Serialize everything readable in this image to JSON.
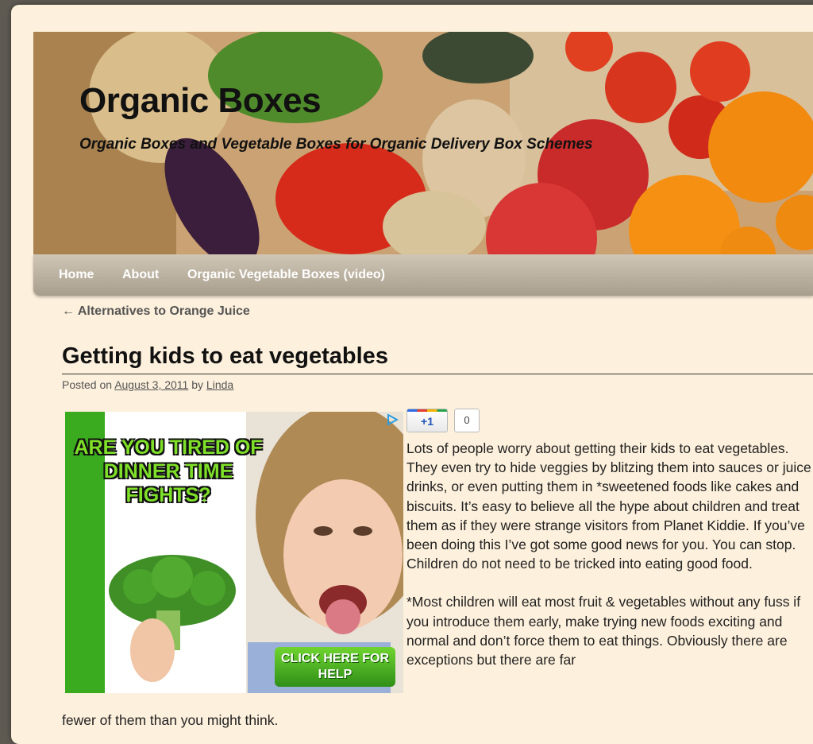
{
  "site": {
    "title": "Organic Boxes",
    "description": "Organic Boxes and Vegetable Boxes for Organic Delivery Box Schemes"
  },
  "nav": {
    "items": [
      {
        "label": "Home"
      },
      {
        "label": "About"
      },
      {
        "label": "Organic Vegetable Boxes (video)"
      }
    ]
  },
  "post": {
    "previous_link": "← Alternatives to Orange Juice",
    "title": "Getting kids to eat vegetables",
    "posted_on_label": "Posted on",
    "date": "August 3, 2011",
    "by_label": "by",
    "author": "Linda",
    "paragraphs": [
      "Lots of people worry about getting their kids to eat vegetables. They even try to hide veggies by blitzing them into sauces or juice drinks, or even putting them in *sweetened foods like cakes and biscuits. It’s easy to believe all the hype about children and treat them as if they were strange visitors from Planet Kiddie. If you’ve been doing this I’ve got some good news for you. You can stop. Children do not need to be tricked into eating good food.",
      "*Most children will eat most fruit & vegetables without any fuss if you introduce them early, make trying new foods exciting and normal and don’t force them to eat things. Obviously there are exceptions but there are far"
    ],
    "paragraph_tail": "fewer of them than you might think."
  },
  "ad": {
    "headline": "Are you tired of dinner time fights?",
    "cta": "CLICK HERE FOR HELP"
  },
  "social": {
    "plusone_label": "+1",
    "plusone_count": "0"
  }
}
